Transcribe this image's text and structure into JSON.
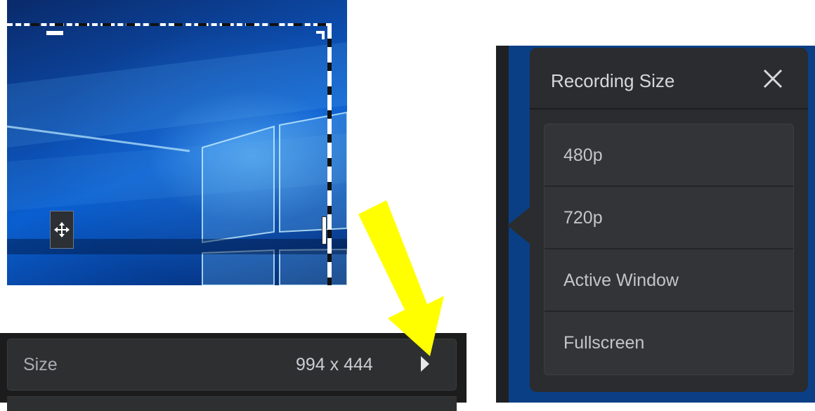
{
  "size_panel": {
    "label": "Size",
    "value": "994 x 444"
  },
  "popup": {
    "title": "Recording Size",
    "options": [
      {
        "label": "480p"
      },
      {
        "label": "720p"
      },
      {
        "label": "Active Window"
      },
      {
        "label": "Fullscreen"
      }
    ]
  },
  "colors": {
    "annotation_arrow": "#ffff00",
    "popup_bg": "#2a2c2f",
    "panel_bg": "#2d2f31"
  },
  "icons": {
    "move": "move-arrows-icon",
    "close": "close-icon",
    "expand": "triangle-right-icon"
  }
}
